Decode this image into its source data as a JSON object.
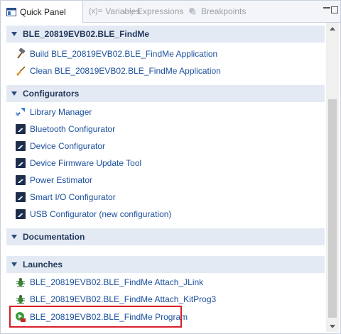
{
  "tabs": [
    {
      "label": "Quick Panel",
      "icon": "quick-panel-icon",
      "active": true
    },
    {
      "label": "Variables",
      "icon": "variables-icon",
      "prefix": "(x)="
    },
    {
      "label": "Expressions",
      "icon": "expressions-icon"
    },
    {
      "label": "Breakpoints",
      "icon": "breakpoints-icon"
    }
  ],
  "sections": {
    "project": {
      "title": "BLE_20819EVB02.BLE_FindMe",
      "items": [
        {
          "label": "Build BLE_20819EVB02.BLE_FindMe Application",
          "icon": "hammer-icon"
        },
        {
          "label": "Clean BLE_20819EVB02.BLE_FindMe Application",
          "icon": "broom-icon"
        }
      ]
    },
    "configurators": {
      "title": "Configurators",
      "items": [
        {
          "label": "Library Manager",
          "icon": "library-manager-icon"
        },
        {
          "label": "Bluetooth Configurator",
          "icon": "configurator-icon"
        },
        {
          "label": "Device Configurator",
          "icon": "configurator-icon"
        },
        {
          "label": "Device Firmware Update Tool",
          "icon": "configurator-icon"
        },
        {
          "label": "Power Estimator",
          "icon": "configurator-icon"
        },
        {
          "label": "Smart I/O Configurator",
          "icon": "configurator-icon"
        },
        {
          "label": "USB Configurator (new configuration)",
          "icon": "configurator-icon"
        }
      ]
    },
    "documentation": {
      "title": "Documentation"
    },
    "launches": {
      "title": "Launches",
      "items": [
        {
          "label": "BLE_20819EVB02.BLE_FindMe Attach_JLink",
          "icon": "debug-bug-icon"
        },
        {
          "label": "BLE_20819EVB02.BLE_FindMe Attach_KitProg3",
          "icon": "debug-bug-icon"
        },
        {
          "label": "BLE_20819EVB02.BLE_FindMe Program",
          "icon": "run-program-icon",
          "highlighted": true
        }
      ]
    }
  },
  "colors": {
    "link": "#1b4f9c",
    "section_bg": "#e4eaf3",
    "highlight_border": "#d91e2a"
  }
}
